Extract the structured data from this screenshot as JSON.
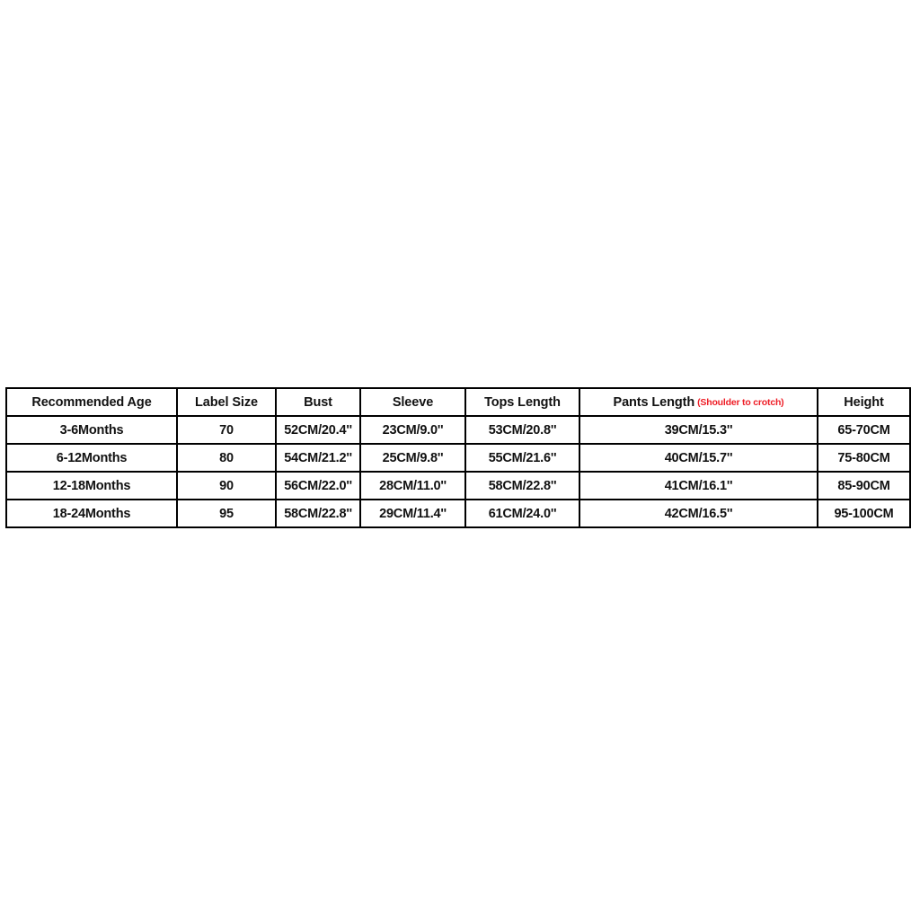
{
  "table": {
    "name": "baby-clothing-size-chart",
    "accent_red": "#ee1c25",
    "text_color": "#111111",
    "border_color": "#000000",
    "background": "#ffffff",
    "headers": [
      {
        "label": "Recommended Age",
        "note": ""
      },
      {
        "label": "Label Size",
        "note": ""
      },
      {
        "label": "Bust",
        "note": ""
      },
      {
        "label": "Sleeve",
        "note": ""
      },
      {
        "label": "Tops Length",
        "note": ""
      },
      {
        "label": "Pants Length",
        "note": "(Shoulder to crotch)"
      },
      {
        "label": "Height",
        "note": ""
      }
    ],
    "rows": [
      {
        "age": "3-6Months",
        "label_size": "70",
        "bust": "52CM/20.4''",
        "sleeve": "23CM/9.0''",
        "tops_length": "53CM/20.8''",
        "pants_length": "39CM/15.3''",
        "height": "65-70CM"
      },
      {
        "age": "6-12Months",
        "label_size": "80",
        "bust": "54CM/21.2''",
        "sleeve": "25CM/9.8''",
        "tops_length": "55CM/21.6''",
        "pants_length": "40CM/15.7''",
        "height": "75-80CM"
      },
      {
        "age": "12-18Months",
        "label_size": "90",
        "bust": "56CM/22.0''",
        "sleeve": "28CM/11.0''",
        "tops_length": "58CM/22.8''",
        "pants_length": "41CM/16.1''",
        "height": "85-90CM"
      },
      {
        "age": "18-24Months",
        "label_size": "95",
        "bust": "58CM/22.8''",
        "sleeve": "29CM/11.4''",
        "tops_length": "61CM/24.0''",
        "pants_length": "42CM/16.5''",
        "height": "95-100CM"
      }
    ]
  }
}
